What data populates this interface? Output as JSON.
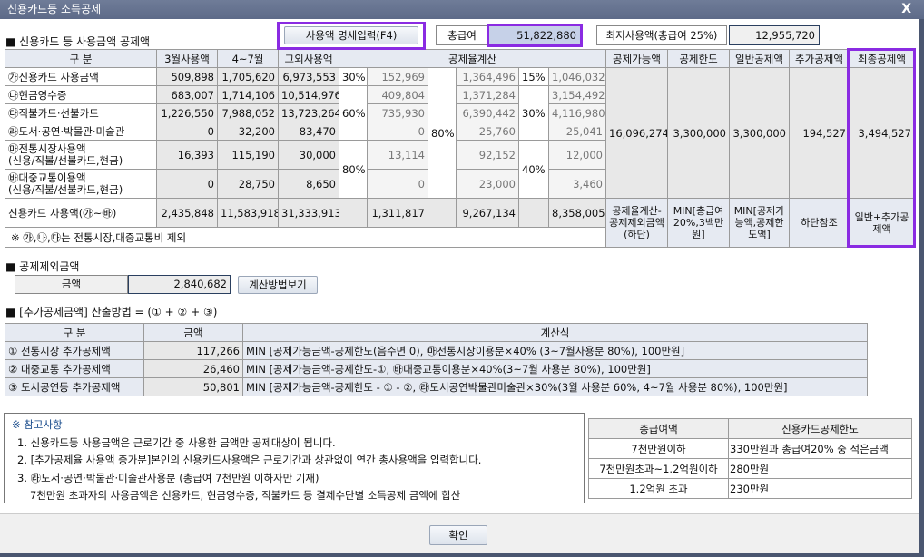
{
  "window": {
    "title": "신용카드등 소득공제",
    "close": "X"
  },
  "top": {
    "section_title": "■ 신용카드 등 사용금액 공제액",
    "detail_button": "사용액 명세입력(F4)",
    "salary_label": "총급여",
    "salary_value": "51,822,880",
    "min_label": "최저사용액(총급여 25%)",
    "min_value": "12,955,720"
  },
  "main_table": {
    "headers": [
      "구  분",
      "3월사용액",
      "4~7월",
      "그외사용액",
      "공제율계산",
      "공제가능액",
      "공제한도",
      "일반공제액",
      "추가공제액",
      "최종공제액"
    ],
    "rows": [
      {
        "label": "㉮신용카드 사용금액",
        "m3": "509,898",
        "m47": "1,705,620",
        "other": "6,973,553",
        "a": "152,969",
        "b": "1,364,496",
        "c": "1,046,032"
      },
      {
        "label": "㉯현금영수증",
        "m3": "683,007",
        "m47": "1,714,106",
        "other": "10,514,976",
        "a": "409,804",
        "b": "1,371,284",
        "c": "3,154,492"
      },
      {
        "label": "㉰직불카드·선불카드",
        "m3": "1,226,550",
        "m47": "7,988,052",
        "other": "13,723,264",
        "a": "735,930",
        "b": "6,390,442",
        "c": "4,116,980"
      },
      {
        "label": "㉱도서·공연·박물관·미술관",
        "m3": "0",
        "m47": "32,200",
        "other": "83,470",
        "a": "0",
        "b": "25,760",
        "c": "25,041"
      },
      {
        "label": "㉲전통시장사용액",
        "label2": "(신용/직불/선불카드,현금)",
        "m3": "16,393",
        "m47": "115,190",
        "other": "30,000",
        "a": "13,114",
        "b": "92,152",
        "c": "12,000"
      },
      {
        "label": "㉳대중교통이용액",
        "label2": "(신용/직불/선불카드,현금)",
        "m3": "0",
        "m47": "28,750",
        "other": "8,650",
        "a": "0",
        "b": "23,000",
        "c": "3,460"
      }
    ],
    "rates1": [
      "30%",
      "60%",
      "80%"
    ],
    "rate_mid": "80%",
    "rates2": [
      "15%",
      "30%",
      "40%"
    ],
    "total": {
      "label": "신용카드 사용액(㉮~㉳)",
      "m3": "2,435,848",
      "m47": "11,583,918",
      "other": "31,333,913",
      "a": "1,311,817",
      "b": "9,267,134",
      "c": "8,358,005"
    },
    "summary": {
      "possible": "16,096,274",
      "limit": "3,300,000",
      "general": "3,300,000",
      "additional": "194,527",
      "final": "3,494,527"
    },
    "summary_desc": {
      "possible": "공제율계산-공제제외금액(하단)",
      "limit": "MIN[총급여20%,3백만원]",
      "general": "MIN[공제가능액,공제한도액]",
      "additional": "하단참조",
      "final": "일반+추가공제액"
    },
    "note": "※ ㉮,㉯,㉰는 전통시장,대중교통비 제외"
  },
  "exclusion": {
    "section_title": "■ 공제제외금액",
    "label": "금액",
    "value": "2,840,682",
    "button": "계산방법보기"
  },
  "additional": {
    "section_title": "■ [추가공제금액] 산출방법 = (① + ② + ③)",
    "headers": [
      "구  분",
      "금액",
      "계산식"
    ],
    "rows": [
      {
        "label": "① 전통시장 추가공제액",
        "amount": "117,266",
        "formula": "MIN [공제가능금액-공제한도(음수면 0), ㉲전통시장이용분×40% (3~7월사용분 80%), 100만원]"
      },
      {
        "label": "② 대중교통 추가공제액",
        "amount": "26,460",
        "formula": "MIN [공제가능금액-공제한도-①, ㉳대중교통이용분×40%(3~7월 사용분 80%), 100만원]"
      },
      {
        "label": "③ 도서공연등 추가공제액",
        "amount": "50,801",
        "formula": "MIN [공제가능금액-공제한도 - ① - ②, ㉱도서공연박물관미술관×30%(3월 사용분 60%, 4~7월 사용분 80%), 100만원]"
      }
    ]
  },
  "notes": {
    "title": "※ 참고사항",
    "items": [
      "1. 신용카드등 사용금액은 근로기간 중 사용한 금액만 공제대상이 됩니다.",
      "2. [추가공제율 사용액 증가분]본인의 신용카드사용액은 근로기간과 상관없이 연간 총사용액을 입력합니다.",
      "3. ㉱도서·공연·박물관·미술관사용분 (총급여 7천만원 이하자만 기재)",
      "7천만원 초과자의 사용금액은 신용카드, 현금영수증, 직불카드 등 결제수단별 소득공제 금액에 합산"
    ]
  },
  "limit_table": {
    "headers": [
      "총급여액",
      "신용카드공제한도"
    ],
    "rows": [
      [
        "7천만원이하",
        "330만원과 총급여20% 중 적은금액"
      ],
      [
        "7천만원초과~1.2억원이하",
        "280만원"
      ],
      [
        "1.2억원 초과",
        "230만원"
      ]
    ]
  },
  "footer": {
    "ok": "확인"
  },
  "colors": {
    "highlight": "#8a2be2",
    "header": "#e6eaf2",
    "title_bar": "#64708e"
  }
}
